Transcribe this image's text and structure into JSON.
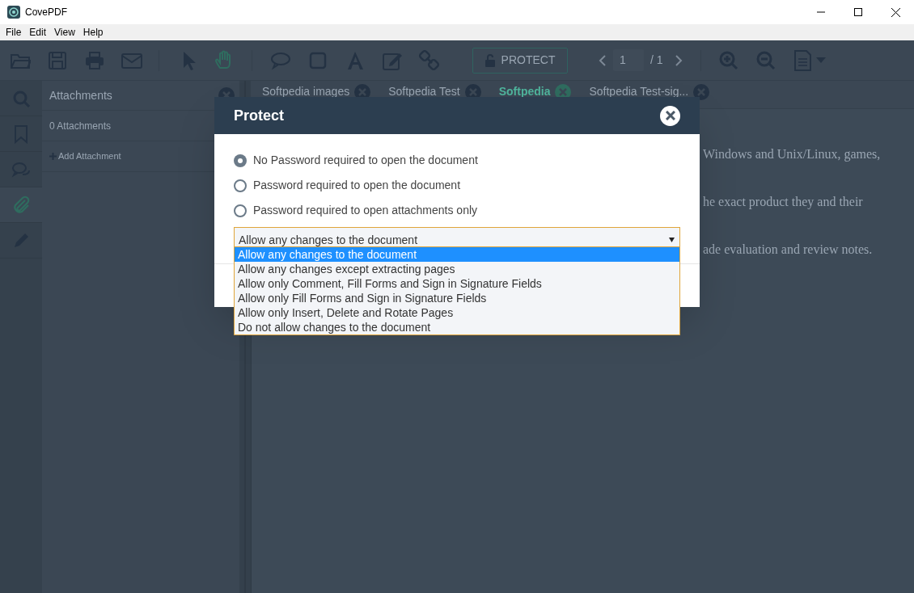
{
  "window": {
    "title": "CovePDF"
  },
  "menu": [
    "File",
    "Edit",
    "View",
    "Help"
  ],
  "toolbar": {
    "tools": [
      {
        "kind": "open"
      },
      {
        "kind": "save"
      },
      {
        "kind": "print"
      },
      {
        "kind": "mail"
      },
      {
        "kind": "pointer",
        "selected": false
      },
      {
        "kind": "hand",
        "selected": true
      },
      {
        "kind": "comment"
      },
      {
        "kind": "rectangle"
      },
      {
        "kind": "text"
      },
      {
        "kind": "edit"
      },
      {
        "kind": "link"
      }
    ],
    "protect_button": "PROTECT",
    "page_number": "1",
    "page_total": "/ 1"
  },
  "sidebar": {
    "items": [
      {
        "kind": "search",
        "selected": false
      },
      {
        "kind": "bookmark",
        "selected": false
      },
      {
        "kind": "comments",
        "selected": false
      },
      {
        "kind": "attachment",
        "selected": true
      },
      {
        "kind": "pencil",
        "selected": false
      }
    ]
  },
  "attachments_panel": {
    "title": "Attachments",
    "count": "0 Attachments",
    "add_link": "Add Attachment"
  },
  "tabs": [
    {
      "label": "Softpedia images",
      "selected": false
    },
    {
      "label": "Softpedia Test",
      "selected": false
    },
    {
      "label": "Softpedia",
      "selected": true
    },
    {
      "label": "Softpedia Test-sig...",
      "selected": false
    }
  ],
  "document": {
    "lines": [
      "Windows and Unix/Linux, games,",
      "he exact product they and their",
      "ade evaluation and review notes."
    ]
  },
  "dialog": {
    "title": "Protect",
    "options": [
      {
        "label": "No Password required to open the document",
        "selected": true
      },
      {
        "label": "Password required to open the document",
        "selected": false
      },
      {
        "label": "Password required to open attachments only",
        "selected": false
      }
    ],
    "permissions": {
      "value": "Allow any changes to the document",
      "expanded": true,
      "options": [
        {
          "label": "Allow any changes to the document",
          "selected": true
        },
        {
          "label": "Allow any changes except extracting pages",
          "selected": false
        },
        {
          "label": "Allow only Comment, Fill Forms and Sign in Signature Fields",
          "selected": false
        },
        {
          "label": "Allow only Fill Forms and Sign in Signature Fields",
          "selected": false
        },
        {
          "label": "Allow only Insert, Delete and Rotate Pages",
          "selected": false
        },
        {
          "label": "Do not allow changes to the document",
          "selected": false
        }
      ]
    }
  }
}
